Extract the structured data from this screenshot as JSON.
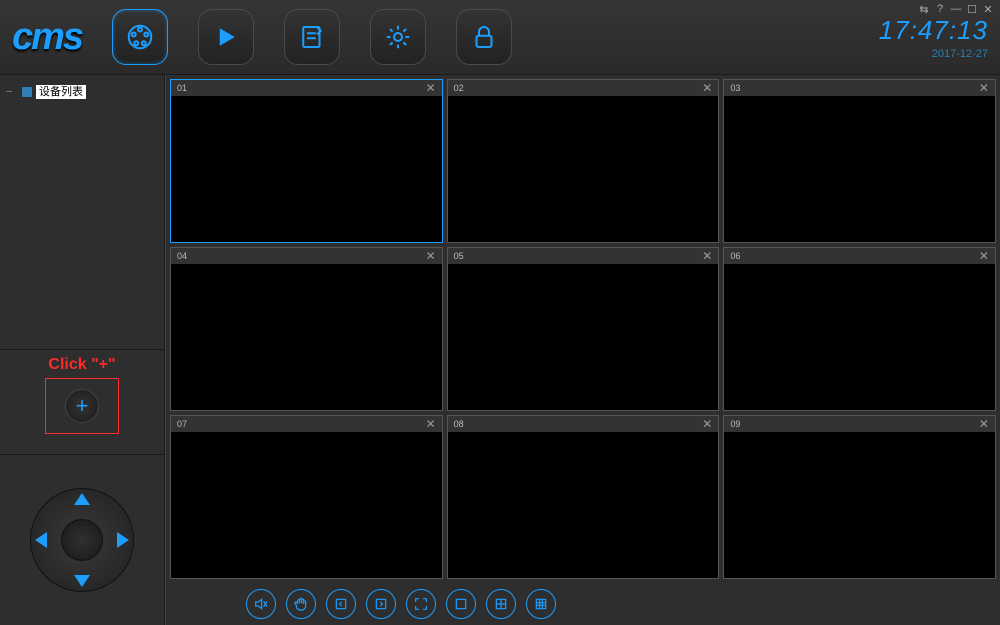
{
  "logo": "cms",
  "clock": {
    "time": "17:47:13",
    "date": "2017-12-27"
  },
  "window_controls": [
    "swap-icon",
    "help-icon",
    "minimize-icon",
    "maximize-icon",
    "close-icon"
  ],
  "header_buttons": [
    {
      "name": "live-view-button",
      "icon": "reel",
      "active": true
    },
    {
      "name": "playback-button",
      "icon": "play",
      "active": false
    },
    {
      "name": "log-button",
      "icon": "log",
      "active": false
    },
    {
      "name": "settings-button",
      "icon": "gear",
      "active": false
    },
    {
      "name": "lock-button",
      "icon": "lock",
      "active": false
    }
  ],
  "sidebar": {
    "tree_root_label": "设备列表",
    "add_annotation": "Click \"+\""
  },
  "tiles": [
    {
      "num": "01",
      "active": true
    },
    {
      "num": "02",
      "active": false
    },
    {
      "num": "03",
      "active": false
    },
    {
      "num": "04",
      "active": false
    },
    {
      "num": "05",
      "active": false
    },
    {
      "num": "06",
      "active": false
    },
    {
      "num": "07",
      "active": false
    },
    {
      "num": "08",
      "active": false
    },
    {
      "num": "09",
      "active": false
    }
  ],
  "toolbar": [
    "mute-button",
    "grab-button",
    "prev-page-button",
    "next-page-button",
    "fullscreen-button",
    "layout-1-button",
    "layout-4-button",
    "layout-9-button"
  ],
  "colors": {
    "accent": "#1c9eff",
    "annotation": "#ff2a2a",
    "bg": "#2a2a2a"
  }
}
